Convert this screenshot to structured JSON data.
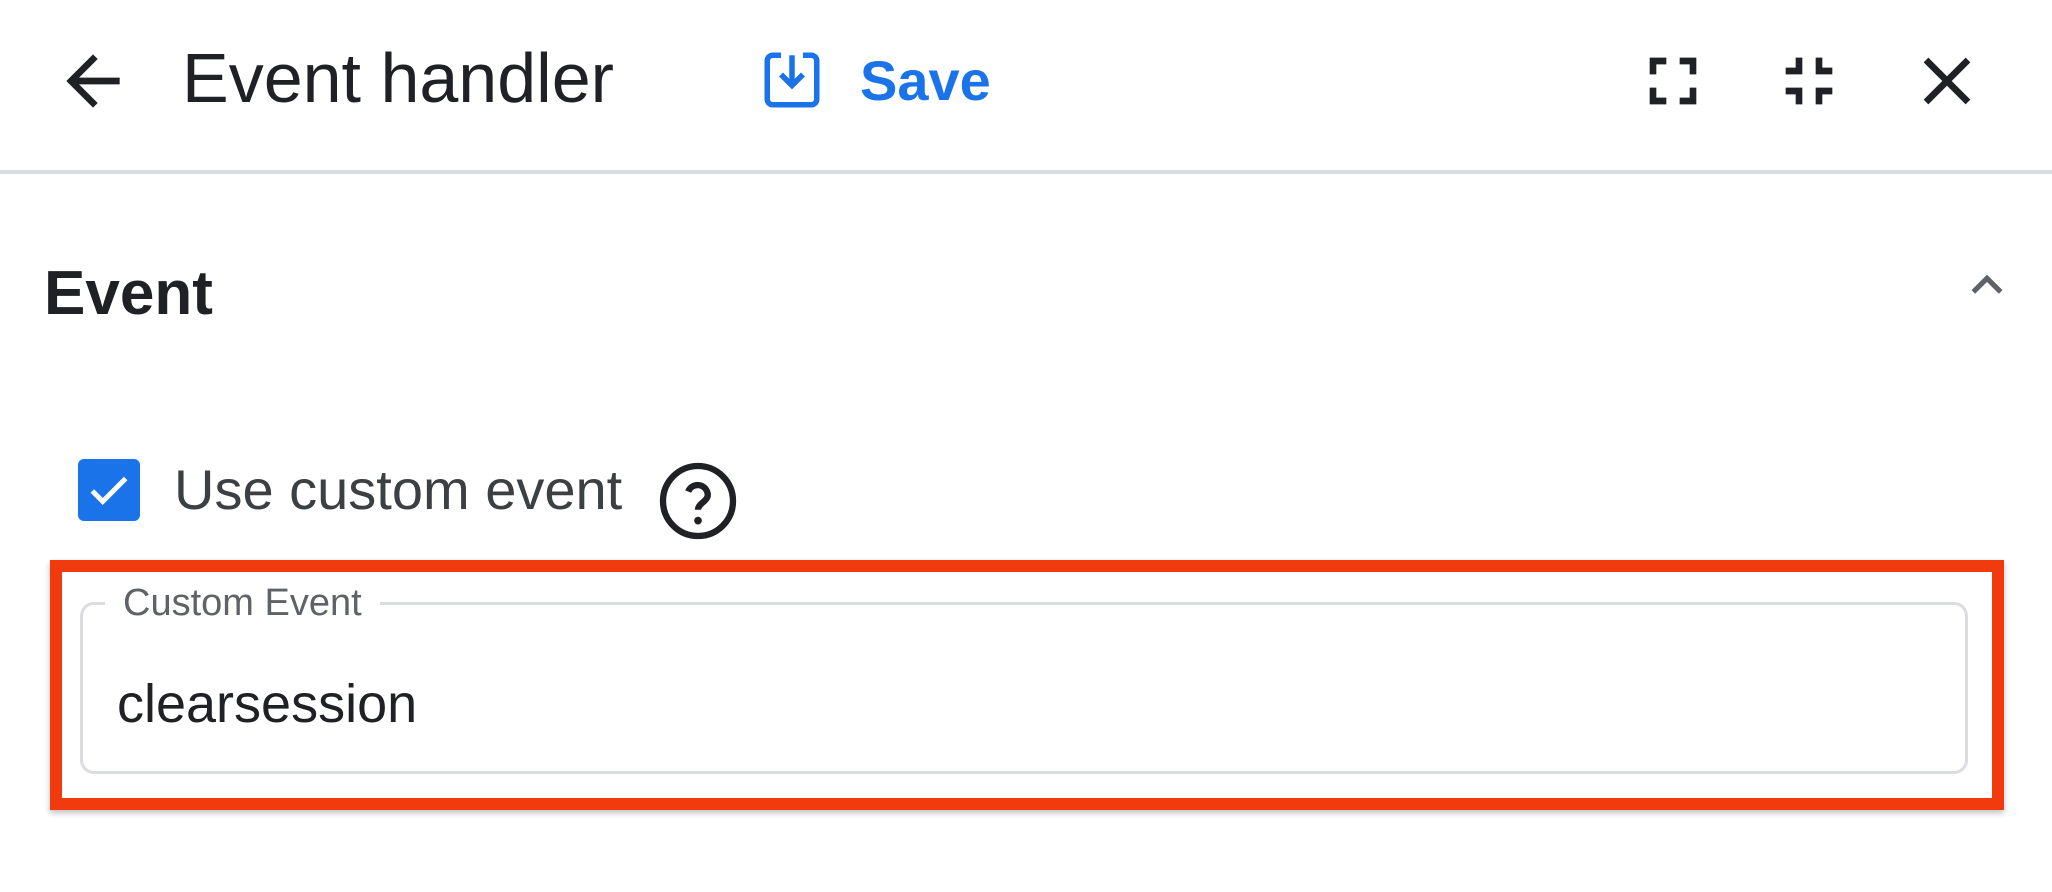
{
  "header": {
    "title": "Event handler",
    "back_icon": "arrow-back-icon",
    "save": {
      "label": "Save",
      "icon": "save-download-icon",
      "color": "#1a73e8"
    },
    "actions": [
      "fullscreen-icon",
      "fullscreen-exit-icon",
      "close-icon"
    ]
  },
  "section": {
    "title": "Event",
    "expanded": true,
    "chevron_icon": "chevron-up-icon"
  },
  "custom_event_toggle": {
    "label": "Use custom event",
    "checked": true,
    "help_icon": "help-circle-icon"
  },
  "custom_event_field": {
    "label": "Custom Event",
    "value": "clearsession",
    "highlighted": true,
    "highlight_color": "#f23a0f"
  }
}
